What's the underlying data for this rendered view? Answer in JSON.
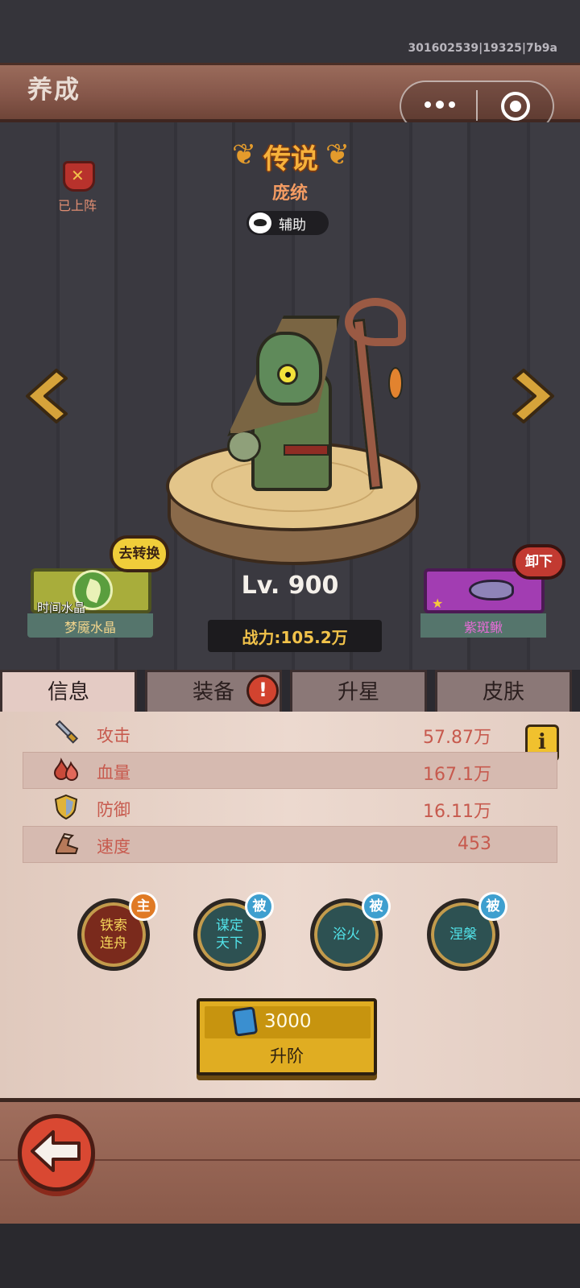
{
  "status": {
    "build_id": "301602539|19325|7b9a"
  },
  "header": {
    "title": "养成",
    "menu_icon": "more-dots-icon",
    "close_icon": "target-icon"
  },
  "hero": {
    "deployed_label": "已上阵",
    "rarity": "传说",
    "name": "庞统",
    "role": "辅助",
    "level": "Lv. 900",
    "power": "战力:105.2万"
  },
  "equipment_left": {
    "caption": "时间水晶",
    "label": "梦魇水晶",
    "action": "去转换"
  },
  "equipment_right": {
    "label": "紫斑鳅",
    "action": "卸下"
  },
  "tabs": [
    {
      "label": "信息"
    },
    {
      "label": "装备"
    },
    {
      "label": "升星"
    },
    {
      "label": "皮肤"
    }
  ],
  "stats": [
    {
      "label": "攻击",
      "value": "57.87万",
      "icon": "sword-icon"
    },
    {
      "label": "血量",
      "value": "167.1万",
      "icon": "blood-icon"
    },
    {
      "label": "防御",
      "value": "16.11万",
      "icon": "shield-icon"
    },
    {
      "label": "速度",
      "value": "453",
      "icon": "boot-icon"
    }
  ],
  "info_button": "i",
  "skills": [
    {
      "line1": "铁索",
      "line2": "连舟",
      "tag": "主"
    },
    {
      "line1": "谋定",
      "line2": "天下",
      "tag": "被"
    },
    {
      "line1": "浴火",
      "line2": "",
      "tag": "被"
    },
    {
      "line1": "涅槃",
      "line2": "",
      "tag": "被"
    }
  ],
  "upgrade": {
    "cost": "3000",
    "label": "升阶"
  },
  "colors": {
    "accent_gold": "#f1c24a",
    "stat_text": "#c75a4e",
    "back_red": "#d94832"
  }
}
